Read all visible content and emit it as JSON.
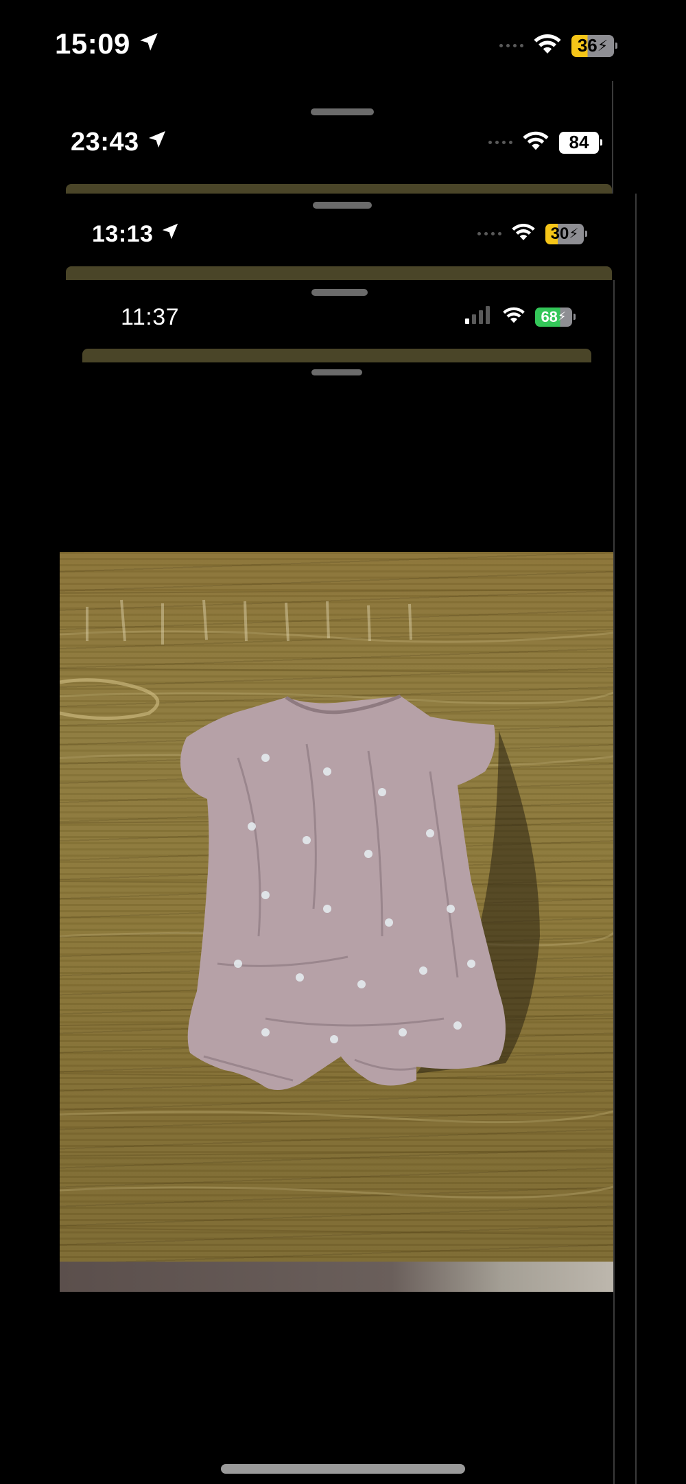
{
  "status_bars": [
    {
      "time": "15:09",
      "battery": "36"
    },
    {
      "time": "23:43",
      "battery": "84"
    },
    {
      "time": "13:13",
      "battery": "30"
    },
    {
      "time": "11:37",
      "battery": "68"
    }
  ],
  "icons": {
    "location": "location-arrow-icon",
    "wifi": "wifi-icon",
    "signal": "cellular-signal-icon",
    "battery": "battery-icon",
    "charging": "charging-bolt-icon"
  },
  "colors": {
    "background": "#000000",
    "battery_yellow": "#f5c518",
    "battery_green": "#34c759",
    "battery_white": "#ffffff",
    "wood": "#8a7538",
    "romper": "#b6a1a7"
  },
  "photo": {
    "subject": "romper-photo"
  }
}
